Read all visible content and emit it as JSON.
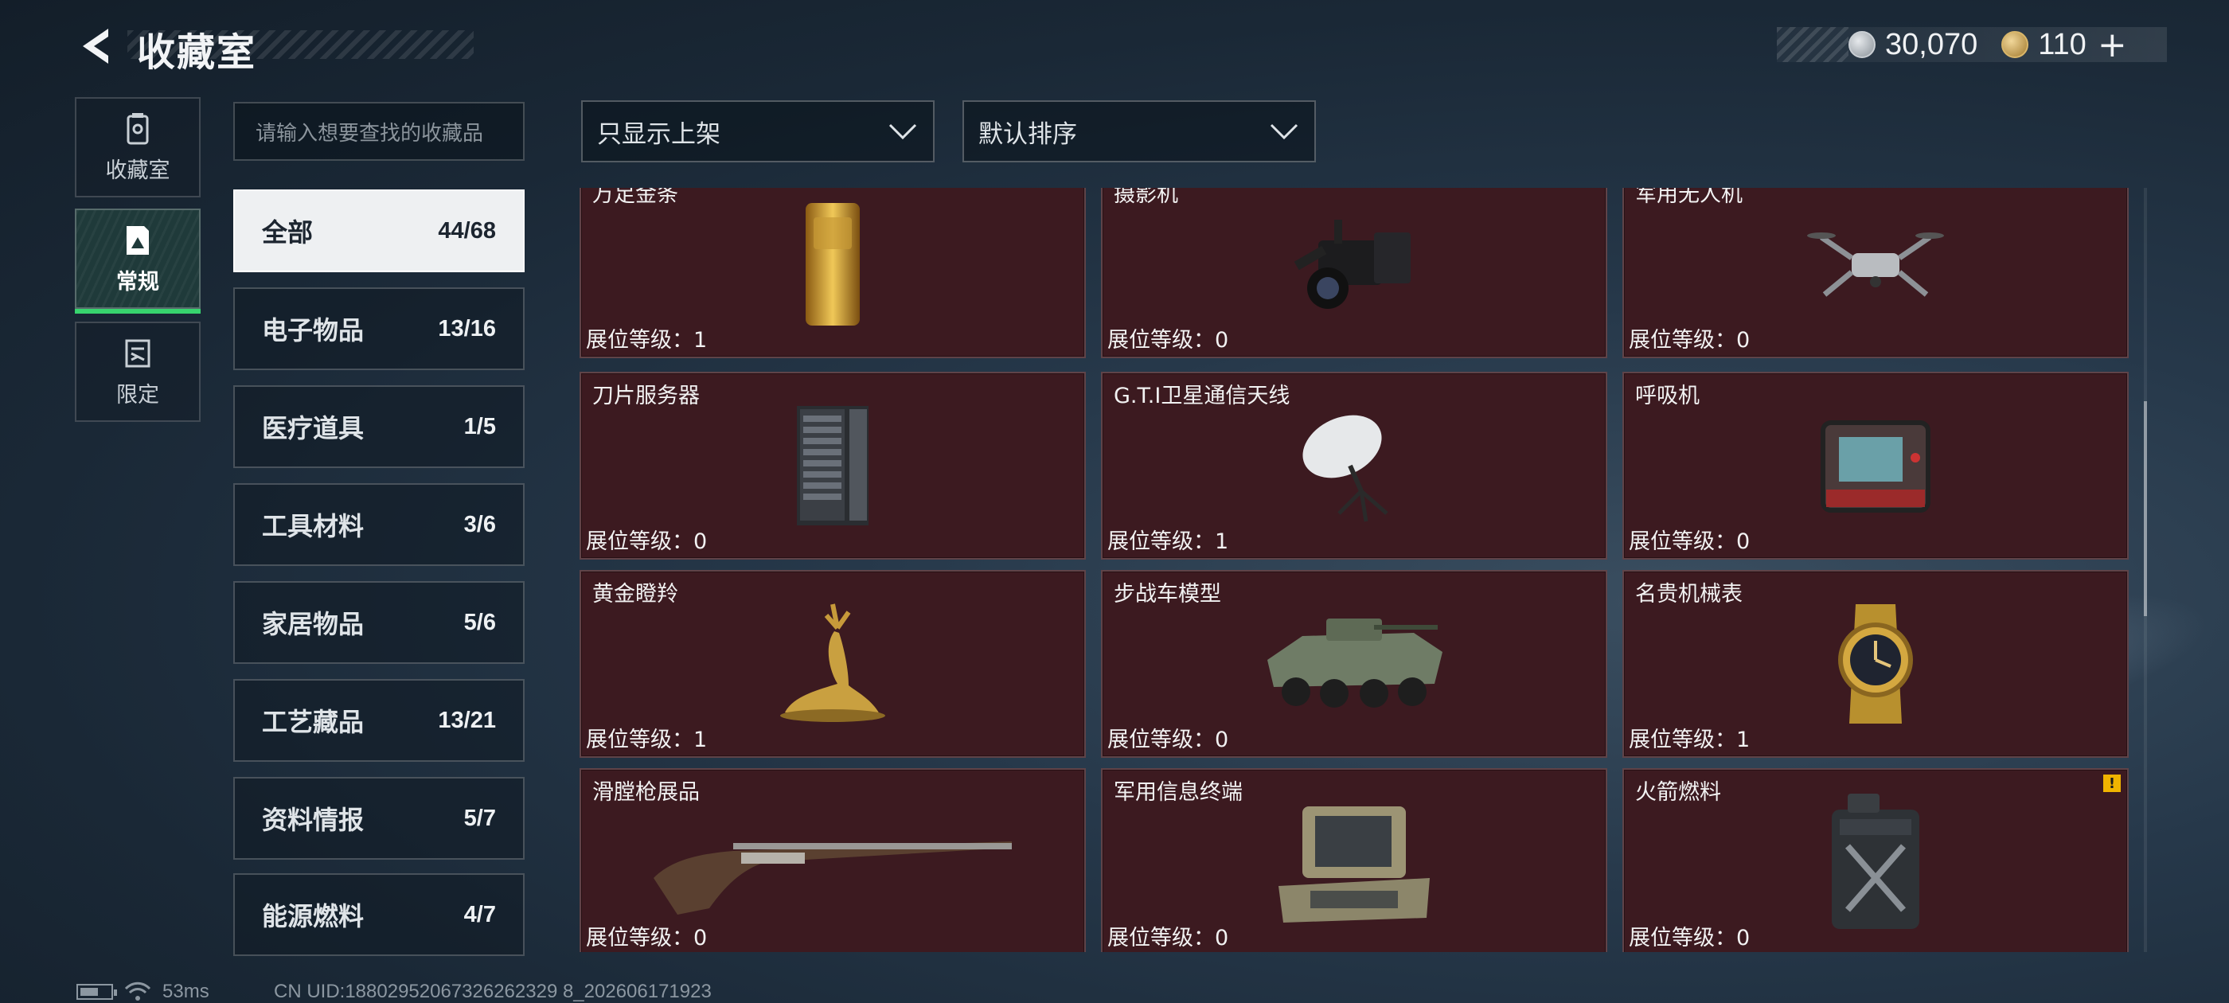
{
  "header": {
    "title": "收藏室",
    "currency_silver": "30,070",
    "currency_gold": "110",
    "plus_label": "+"
  },
  "nav": [
    {
      "label": "收藏室",
      "icon": "collection-room-icon",
      "active": false
    },
    {
      "label": "常规",
      "icon": "regular-items-icon",
      "active": true
    },
    {
      "label": "限定",
      "icon": "limited-items-icon",
      "active": false
    }
  ],
  "search": {
    "placeholder": "请输入想要查找的收藏品"
  },
  "filters": {
    "display": "只显示上架",
    "sort": "默认排序"
  },
  "categories": [
    {
      "name": "全部",
      "count": "44/68"
    },
    {
      "name": "电子物品",
      "count": "13/16"
    },
    {
      "name": "医疗道具",
      "count": "1/5"
    },
    {
      "name": "工具材料",
      "count": "3/6"
    },
    {
      "name": "家居物品",
      "count": "5/6"
    },
    {
      "name": "工艺藏品",
      "count": "13/21"
    },
    {
      "name": "资料情报",
      "count": "5/7"
    },
    {
      "name": "能源燃料",
      "count": "4/7"
    }
  ],
  "level_prefix": "展位等级：",
  "items": [
    {
      "name": "万足金条",
      "level": "1",
      "icon": "gold-bar-icon"
    },
    {
      "name": "摄影机",
      "level": "0",
      "icon": "video-camera-icon"
    },
    {
      "name": "军用无人机",
      "level": "0",
      "icon": "drone-icon"
    },
    {
      "name": "刀片服务器",
      "level": "0",
      "icon": "blade-server-icon"
    },
    {
      "name": "G.T.I卫星通信天线",
      "level": "1",
      "icon": "satellite-dish-icon"
    },
    {
      "name": "呼吸机",
      "level": "0",
      "icon": "ventilator-icon"
    },
    {
      "name": "黄金瞪羚",
      "level": "1",
      "icon": "golden-gazelle-icon"
    },
    {
      "name": "步战车模型",
      "level": "0",
      "icon": "ifv-model-icon"
    },
    {
      "name": "名贵机械表",
      "level": "1",
      "icon": "luxury-watch-icon"
    },
    {
      "name": "滑膛枪展品",
      "level": "0",
      "icon": "musket-icon"
    },
    {
      "name": "军用信息终端",
      "level": "0",
      "icon": "military-terminal-icon"
    },
    {
      "name": "火箭燃料",
      "level": "0",
      "icon": "fuel-can-icon",
      "warning": "!"
    }
  ],
  "status": {
    "ping": "53ms",
    "uid": "CN UID:18802952067326262329 8_202606171923"
  }
}
